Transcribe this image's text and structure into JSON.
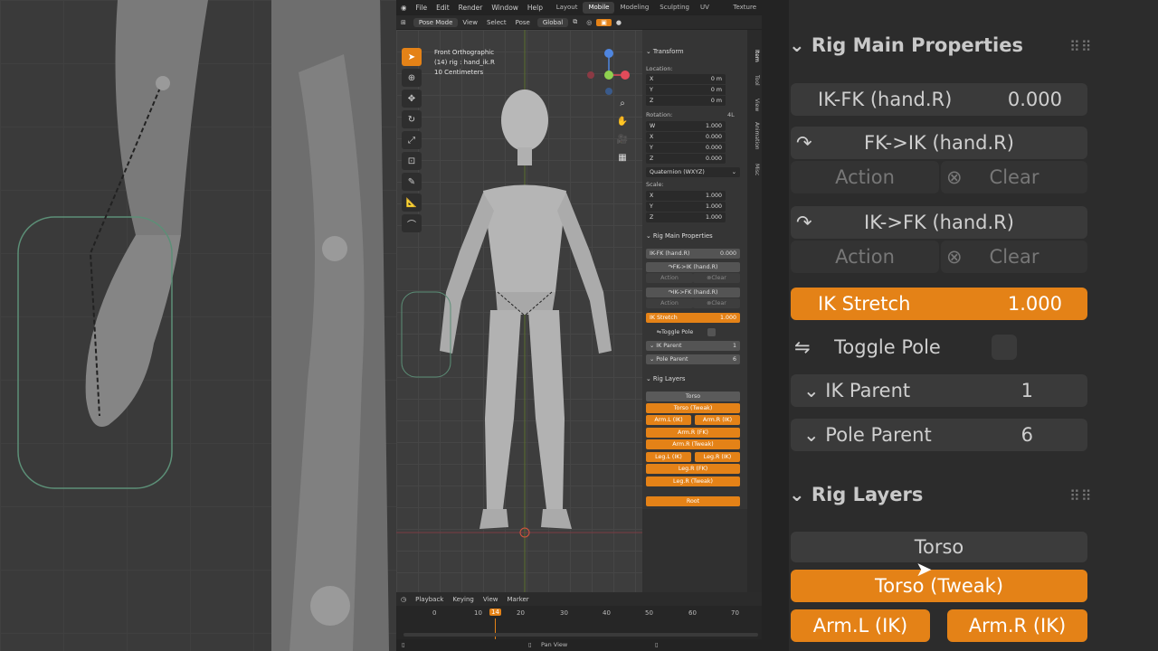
{
  "topbar": {
    "menus": [
      "File",
      "Edit",
      "Render",
      "Window",
      "Help"
    ],
    "workspaces": [
      "Layout",
      "Mobile",
      "Modeling",
      "Sculpting",
      "UV Editing",
      "Texture Paint"
    ],
    "active_workspace": "Mobile"
  },
  "header": {
    "mode": "Pose Mode",
    "menus": [
      "View",
      "Select",
      "Pose"
    ],
    "orientation": "Global",
    "pose_options": "Pose Options"
  },
  "viewport": {
    "view_name": "Front Orthographic",
    "object_info": "(14) rig : hand_ik.R",
    "scale": "10 Centimeters"
  },
  "transform": {
    "title": "Transform",
    "location_label": "Location:",
    "location": [
      {
        "axis": "X",
        "value": "0 m"
      },
      {
        "axis": "Y",
        "value": "0 m"
      },
      {
        "axis": "Z",
        "value": "0 m"
      }
    ],
    "rotation_label": "Rotation:",
    "rotation_mode_badge": "4L",
    "rotation": [
      {
        "axis": "W",
        "value": "1.000"
      },
      {
        "axis": "X",
        "value": "0.000"
      },
      {
        "axis": "Y",
        "value": "0.000"
      },
      {
        "axis": "Z",
        "value": "0.000"
      }
    ],
    "rotation_mode": "Quaternion (WXYZ)",
    "scale_label": "Scale:",
    "scale": [
      {
        "axis": "X",
        "value": "1.000"
      },
      {
        "axis": "Y",
        "value": "1.000"
      },
      {
        "axis": "Z",
        "value": "1.000"
      }
    ]
  },
  "rig_main": {
    "title": "Rig Main Properties",
    "ikfk_label": "IK-FK (hand.R)",
    "ikfk_value": "0.000",
    "fk_to_ik": "FK->IK (hand.R)",
    "ik_to_fk": "IK->FK (hand.R)",
    "action": "Action",
    "clear": "Clear",
    "ik_stretch_label": "IK Stretch",
    "ik_stretch_value": "1.000",
    "toggle_pole": "Toggle Pole",
    "ik_parent_label": "IK Parent",
    "ik_parent_value": "1",
    "pole_parent_label": "Pole Parent",
    "pole_parent_value": "6"
  },
  "rig_layers": {
    "title": "Rig Layers",
    "torso": "Torso",
    "torso_tweak": "Torso (Tweak)",
    "arm_l_ik": "Arm.L (IK)",
    "arm_r_ik": "Arm.R (IK)",
    "arm_r_fk": "Arm.R (FK)",
    "arm_r_tweak": "Arm.R (Tweak)",
    "leg_l_ik": "Leg.L (IK)",
    "leg_r_ik": "Leg.R (IK)",
    "leg_r_fk": "Leg.R (FK)",
    "leg_r_tweak": "Leg.R (Tweak)",
    "root": "Root"
  },
  "side_tabs": [
    "Item",
    "Tool",
    "View",
    "Animation",
    "Misc"
  ],
  "timeline": {
    "menus": [
      "Playback",
      "Keying",
      "View",
      "Marker"
    ],
    "ticks": [
      "0",
      "10",
      "20",
      "30",
      "40",
      "50",
      "60",
      "70"
    ],
    "current_frame": "14",
    "status": "Pan View"
  },
  "colors": {
    "accent": "#e48217",
    "panel": "#353535",
    "field": "#545454"
  }
}
